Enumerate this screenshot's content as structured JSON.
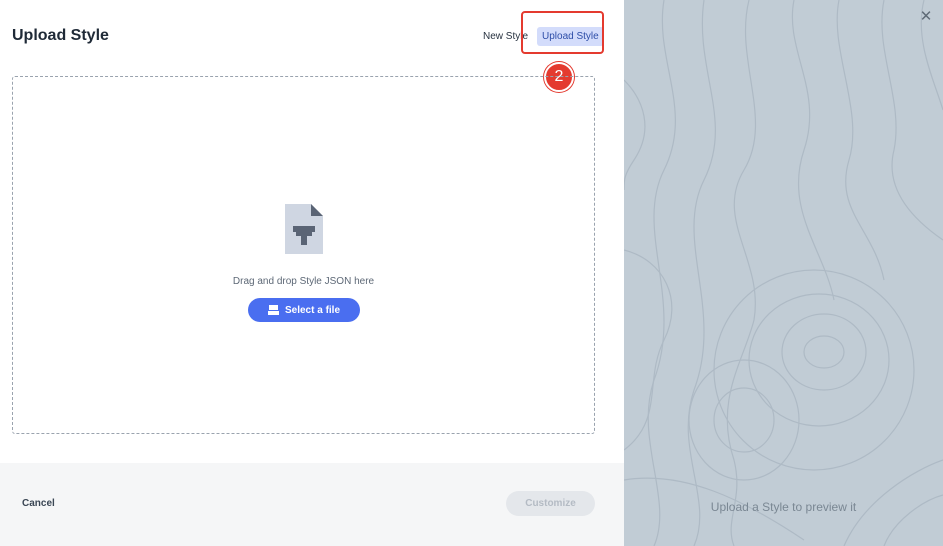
{
  "modal": {
    "title": "Upload Style",
    "tabs": [
      {
        "label": "New Style",
        "active": false
      },
      {
        "label": "Upload Style",
        "active": true
      }
    ],
    "step_badge": "2"
  },
  "dropzone": {
    "instruction": "Drag and drop Style JSON here",
    "select_label": "Select a file",
    "file_icon": "style-file-icon"
  },
  "footer": {
    "cancel_label": "Cancel",
    "customize_label": "Customize"
  },
  "preview": {
    "placeholder": "Upload a Style to preview it",
    "close_icon": "close-icon"
  },
  "colors": {
    "accent": "#4a6ef0",
    "highlight": "#e43a2f",
    "preview_bg": "#c1ccd5"
  }
}
